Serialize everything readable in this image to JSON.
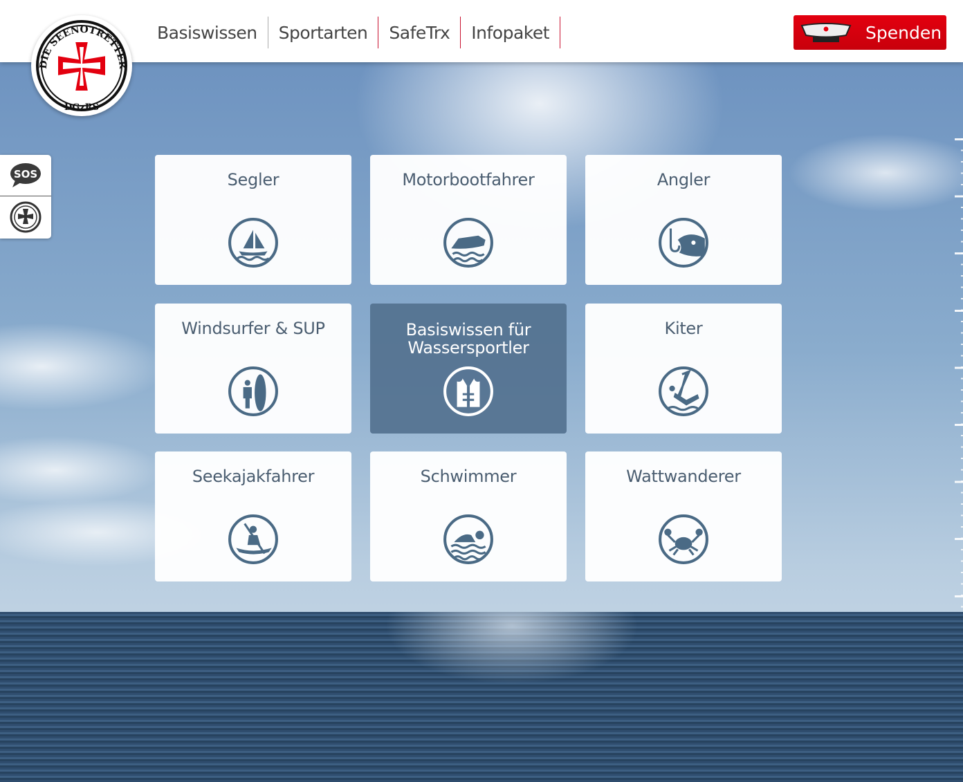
{
  "logo": {
    "text_top": "DIE SEENOTRETTER",
    "text_bottom": "DGzRS"
  },
  "nav": {
    "items": [
      "Basiswissen",
      "Sportarten",
      "SafeTrx",
      "Infopaket"
    ]
  },
  "donate": {
    "label": "Spenden"
  },
  "side": {
    "sos_label": "SOS"
  },
  "colors": {
    "accent": "#e3000f",
    "icon": "#4a6a85",
    "active_card": "#52708e"
  },
  "cards": [
    {
      "label": "Segler",
      "icon": "sailboat-icon"
    },
    {
      "label": "Motorbootfahrer",
      "icon": "motorboat-icon"
    },
    {
      "label": "Angler",
      "icon": "fish-hook-icon"
    },
    {
      "label": "Windsurfer & SUP",
      "icon": "surfer-icon"
    },
    {
      "label": "Basiswissen für Wassersportler",
      "icon": "life-vest-icon",
      "active": true
    },
    {
      "label": "Kiter",
      "icon": "kiter-icon"
    },
    {
      "label": "Seekajakfahrer",
      "icon": "kayak-icon"
    },
    {
      "label": "Schwimmer",
      "icon": "swimmer-icon"
    },
    {
      "label": "Wattwanderer",
      "icon": "crab-icon"
    }
  ]
}
